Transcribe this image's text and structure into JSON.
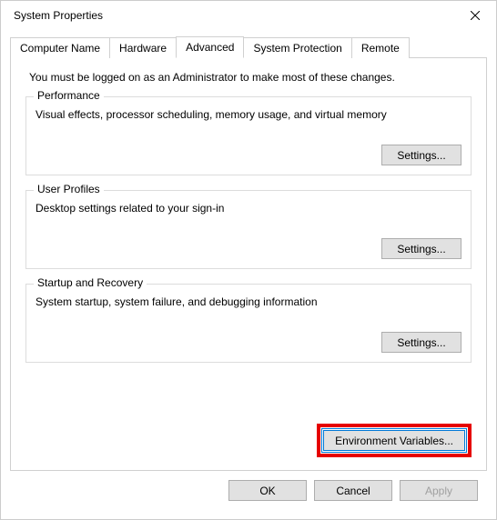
{
  "window": {
    "title": "System Properties"
  },
  "tabs": {
    "computer_name": "Computer Name",
    "hardware": "Hardware",
    "advanced": "Advanced",
    "system_protection": "System Protection",
    "remote": "Remote",
    "active": "advanced"
  },
  "panel": {
    "admin_note": "You must be logged on as an Administrator to make most of these changes.",
    "performance": {
      "title": "Performance",
      "desc": "Visual effects, processor scheduling, memory usage, and virtual memory",
      "settings_label": "Settings..."
    },
    "user_profiles": {
      "title": "User Profiles",
      "desc": "Desktop settings related to your sign-in",
      "settings_label": "Settings..."
    },
    "startup_recovery": {
      "title": "Startup and Recovery",
      "desc": "System startup, system failure, and debugging information",
      "settings_label": "Settings..."
    },
    "env_vars_label": "Environment Variables..."
  },
  "buttons": {
    "ok": "OK",
    "cancel": "Cancel",
    "apply": "Apply"
  }
}
